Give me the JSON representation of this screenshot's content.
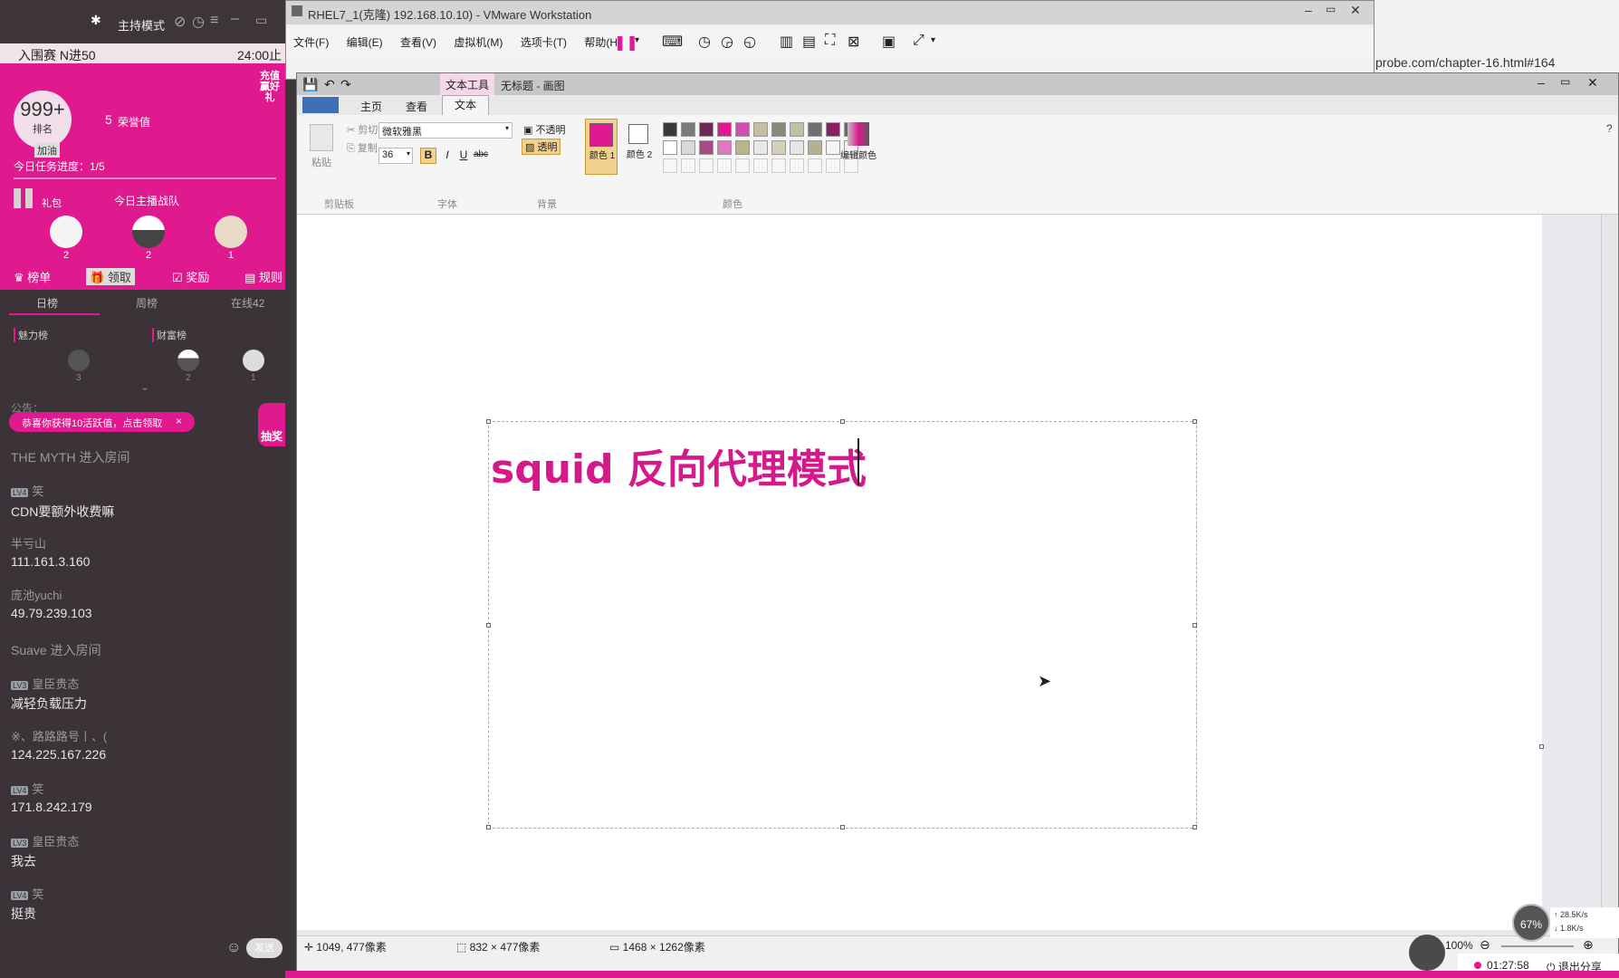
{
  "live": {
    "mode_label": "主持模式",
    "banner_left": "入围赛 N进50",
    "banner_right": "24:00止",
    "rank_number": "999+",
    "rank_label": "排名",
    "rank_sub": "加油",
    "honor_label": "荣誉值",
    "honor_prefix": "5",
    "promo_text": "充值 赢好礼",
    "task_progress": "今日任务进度：1/5",
    "gift_label": "礼包",
    "team_label": "今日主播战队",
    "team_members": [
      {
        "count": "2"
      },
      {
        "count": "2"
      },
      {
        "count": "1"
      }
    ],
    "action_buttons": [
      "榜单",
      "领取",
      "奖励",
      "规则"
    ],
    "tabs": [
      "日榜",
      "周榜",
      "在线42"
    ],
    "charm_label": "魅力榜",
    "wealth_label": "财富榜",
    "wealth_ranks": [
      "3",
      "2",
      "1"
    ],
    "notice_prefix": "公告：",
    "notice_pill": "恭喜你获得10活跃值，点击领取",
    "notice_close": "×",
    "lottery_label": "抽奖",
    "chat": [
      {
        "type": "system",
        "text": "THE MYTH 进入房间"
      },
      {
        "type": "msg",
        "lv": "LV4",
        "name": "笑",
        "msg": "CDN要额外收费嘛"
      },
      {
        "type": "msg",
        "lv": "",
        "name": "半亏山",
        "msg": "111.161.3.160"
      },
      {
        "type": "msg",
        "lv": "",
        "name": "庞池yuchi",
        "msg": "49.79.239.103"
      },
      {
        "type": "system",
        "text": "Suave 进入房间"
      },
      {
        "type": "msg",
        "lv": "LV3",
        "name": "皇臣贵态",
        "msg": "减轻负载压力"
      },
      {
        "type": "msg",
        "lv": "",
        "name": "※、路路路号丨、(",
        "msg": "124.225.167.226"
      },
      {
        "type": "msg",
        "lv": "LV4",
        "name": "笑",
        "msg": "171.8.242.179"
      },
      {
        "type": "msg",
        "lv": "LV3",
        "name": "皇臣贵态",
        "msg": "我去"
      },
      {
        "type": "msg",
        "lv": "LV4",
        "name": "笑",
        "msg": "挺贵"
      }
    ],
    "send_label": "发送"
  },
  "vmware": {
    "title": "RHEL7_1(克隆) 192.168.10.10) - VMware Workstation",
    "menu": [
      "文件(F)",
      "编辑(E)",
      "查看(V)",
      "虚拟机(M)",
      "选项卡(T)",
      "帮助(H)"
    ]
  },
  "browser": {
    "url": "probe.com/chapter-16.html#164"
  },
  "paint": {
    "title_tab": "文本工具",
    "title": "无标题 - 画图",
    "tabs": [
      "主页",
      "查看",
      "文本"
    ],
    "clipboard": {
      "paste": "粘贴",
      "cut": "剪切",
      "copy": "复制",
      "group": "剪贴板"
    },
    "font": {
      "name": "微软雅黑",
      "size": "36",
      "group": "字体",
      "bold": "B",
      "italic": "I",
      "underline": "U",
      "strike": "abc"
    },
    "background": {
      "opaque": "不透明",
      "transparent": "透明",
      "group": "背景"
    },
    "colors": {
      "color1_label": "颜色 1",
      "color2_label": "颜色 2",
      "edit_label": "编辑颜色",
      "group": "颜色",
      "color1": "#e0198f",
      "color2": "#ffffff",
      "palette_row1": [
        "#3a3a3a",
        "#7a7a7a",
        "#6e2a52",
        "#e0198f",
        "#d04fb0",
        "#c4bfa3",
        "#8a8a7a",
        "#c4bfa3",
        "#707070",
        "#8a1f64",
        "#6a6a6a"
      ],
      "palette_row2": [
        "#ffffff",
        "#d8d8d8",
        "#a24b84",
        "#e07ac0",
        "#b8b48c",
        "#e8e8e8",
        "#d5d1b8",
        "#e5e5e5",
        "#b5b190",
        "#f4f4f4",
        "#f4f4f4"
      ]
    },
    "canvas_text": "squid 反向代理模式",
    "canvas_text_color": "#d4198b",
    "status": {
      "cursor_pos": "1049, 477像素",
      "selection_size": "832 × 477像素",
      "image_size": "1468 × 1262像素",
      "zoom": "100%"
    }
  },
  "overlay": {
    "speed_percent": "67%",
    "upload": "28.5K/s",
    "download": "1.8K/s",
    "timer": "01:27:58",
    "exit_share": "退出分享"
  }
}
